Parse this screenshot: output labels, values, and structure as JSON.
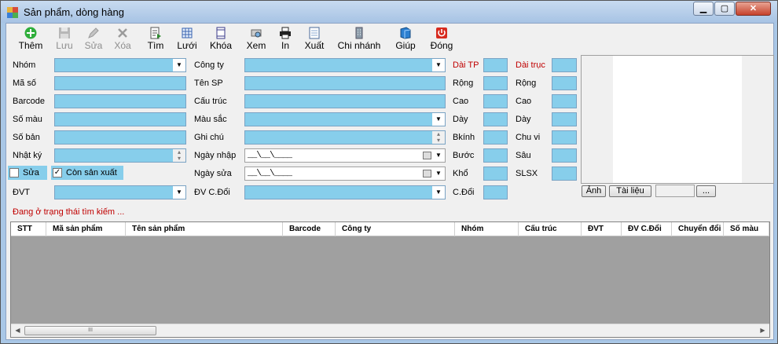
{
  "window": {
    "title": "Sản phẩm, dòng hàng"
  },
  "winbuttons": {
    "minimize": "▁",
    "maximize": "▢",
    "close": "✕"
  },
  "toolbar": {
    "them": "Thêm",
    "luu": "Lưu",
    "sua": "Sửa",
    "xoa": "Xóa",
    "tim": "Tìm",
    "luoi": "Lưới",
    "khoa": "Khóa",
    "xem": "Xem",
    "in": "In",
    "xuat": "Xuất",
    "chinhanh": "Chi nhánh",
    "giup": "Giúp",
    "dong": "Đóng"
  },
  "labels": {
    "nhom": "Nhóm",
    "maso": "Mã số",
    "barcode": "Barcode",
    "somau": "Số màu",
    "soban": "Số bản",
    "nhatky": "Nhật ký",
    "dvt": "ĐVT",
    "congty": "Công ty",
    "tensp": "Tên SP",
    "cautruc": "Cấu trúc",
    "mausac": "Màu sắc",
    "ghichu": "Ghi chú",
    "ngaynhap": "Ngày nhập",
    "ngaysua": "Ngày sửa",
    "dvcdoi": "ĐV C.Đổi",
    "daitp": "Dài TP",
    "rong1": "Rộng",
    "cao1": "Cao",
    "day1": "Dày",
    "bkinh": "Bkính",
    "buoc": "Bước",
    "kho": "Khổ",
    "cdoi": "C.Đổi",
    "daitruc": "Dài trục",
    "rong2": "Rộng",
    "cao2": "Cao",
    "day2": "Dày",
    "chuvi": "Chu vi",
    "sau": "Sâu",
    "slsx": "SLSX"
  },
  "checks": {
    "sua": "Sửa",
    "consanxuat": "Còn sản xuất",
    "sua_checked": "",
    "consanxuat_checked": "✓"
  },
  "dates": {
    "ngaynhap": "__\\__\\____",
    "ngaysua": "__\\__\\____"
  },
  "buttons": {
    "anh": "Ảnh",
    "tailieu": "Tài liệu",
    "browse": "..."
  },
  "status": "Đang ở trạng thái tìm kiếm ...",
  "grid": {
    "columns": [
      "STT",
      "Mã sản phẩm",
      "Tên sản phẩm",
      "Barcode",
      "Công ty",
      "Nhóm",
      "Cấu trúc",
      "ĐVT",
      "ĐV C.Đổi",
      "Chuyển đổi",
      "Số màu"
    ],
    "scroll_thumb": "III"
  },
  "colors": {
    "field": "#87ceeb",
    "label_red": "#c00000",
    "grid_bg": "#a0a0a0"
  }
}
